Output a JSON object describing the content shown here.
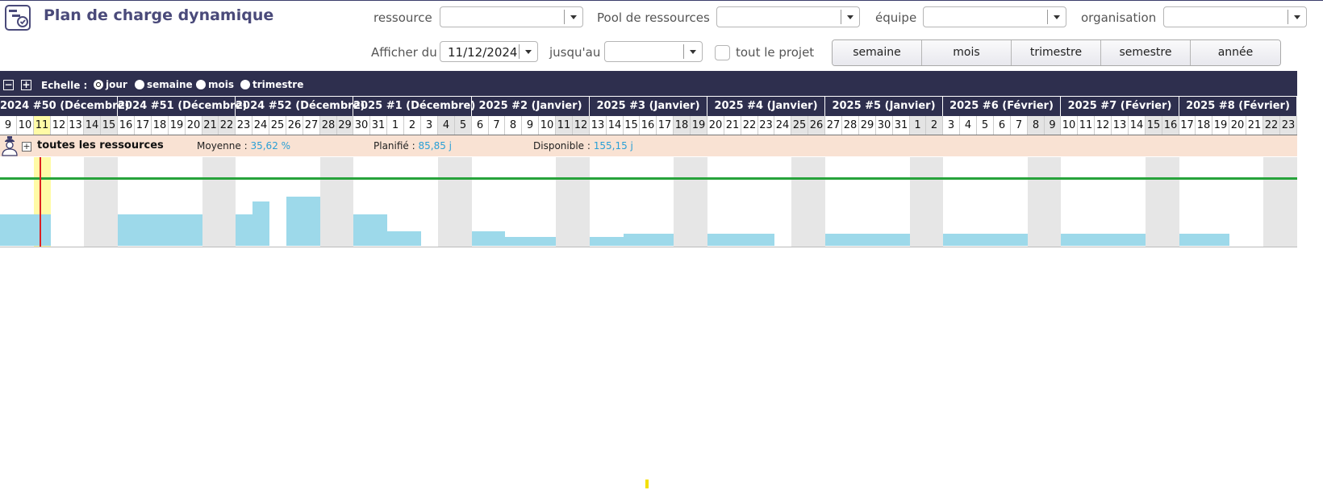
{
  "header": {
    "title": "Plan de charge dynamique",
    "colors": {
      "accent": "#4a4a7a",
      "toolbar": "#2e2f4e"
    }
  },
  "filters": {
    "ressource": {
      "label": "ressource",
      "value": ""
    },
    "pool": {
      "label": "Pool de ressources",
      "value": ""
    },
    "equipe": {
      "label": "équipe",
      "value": ""
    },
    "organisation": {
      "label": "organisation",
      "value": ""
    },
    "afficher_du": {
      "label": "Afficher du",
      "value": "11/12/2024"
    },
    "jusqu_au": {
      "label": "jusqu'au",
      "value": ""
    },
    "tout_projet": {
      "label": "tout le projet",
      "checked": false
    }
  },
  "period_buttons": [
    "semaine",
    "mois",
    "trimestre",
    "semestre",
    "année"
  ],
  "scale": {
    "label": "Echelle :",
    "options": [
      "jour",
      "semaine",
      "mois",
      "trimestre"
    ],
    "selected": "jour"
  },
  "weeks": [
    "2024 #50 (Décembre)",
    "2024 #51 (Décembre)",
    "2024 #52 (Décembre)",
    "2025 #1 (Décembre)",
    "2025 #2 (Janvier)",
    "2025 #3 (Janvier)",
    "2025 #4 (Janvier)",
    "2025 #5 (Janvier)",
    "2025 #6 (Février)",
    "2025 #7 (Février)",
    "2025 #8 (Février)"
  ],
  "days": [
    "9",
    "10",
    "11",
    "12",
    "13",
    "14",
    "15",
    "16",
    "17",
    "18",
    "19",
    "20",
    "21",
    "22",
    "23",
    "24",
    "25",
    "26",
    "27",
    "28",
    "29",
    "30",
    "31",
    "1",
    "2",
    "3",
    "4",
    "5",
    "6",
    "7",
    "8",
    "9",
    "10",
    "11",
    "12",
    "13",
    "14",
    "15",
    "16",
    "17",
    "18",
    "19",
    "20",
    "21",
    "22",
    "23",
    "24",
    "25",
    "26",
    "27",
    "28",
    "29",
    "30",
    "31",
    "1",
    "2",
    "3",
    "4",
    "5",
    "6",
    "7",
    "8",
    "9",
    "10",
    "11",
    "12",
    "13",
    "14",
    "15",
    "16",
    "17",
    "18",
    "19",
    "20",
    "21",
    "22",
    "23"
  ],
  "today_index": 2,
  "resource_row": {
    "name": "toutes les ressources",
    "moyenne_label": "Moyenne :",
    "moyenne_value": "35,62 %",
    "planifie_label": "Planifié :",
    "planifie_value": "85,85 j",
    "disponible_label": "Disponible :",
    "disponible_value": "155,15 j"
  },
  "load_fraction": [
    0.47,
    0.47,
    0.47,
    0,
    0,
    0,
    0,
    0.47,
    0.47,
    0.47,
    0.47,
    0.47,
    0,
    0,
    0.47,
    0.67,
    0,
    0.74,
    0.74,
    0,
    0,
    0.47,
    0.47,
    0.22,
    0.22,
    0,
    0,
    0,
    0.22,
    0.22,
    0.13,
    0.13,
    0.13,
    0,
    0,
    0.13,
    0.13,
    0.18,
    0.18,
    0.18,
    0,
    0,
    0.18,
    0.18,
    0.18,
    0.18,
    0,
    0,
    0,
    0.18,
    0.18,
    0.18,
    0.18,
    0.18,
    0,
    0,
    0.18,
    0.18,
    0.18,
    0.18,
    0.18,
    0,
    0,
    0.18,
    0.18,
    0.18,
    0.18,
    0.18,
    0,
    0,
    0.18,
    0.18,
    0.18,
    0,
    0,
    0,
    0
  ]
}
